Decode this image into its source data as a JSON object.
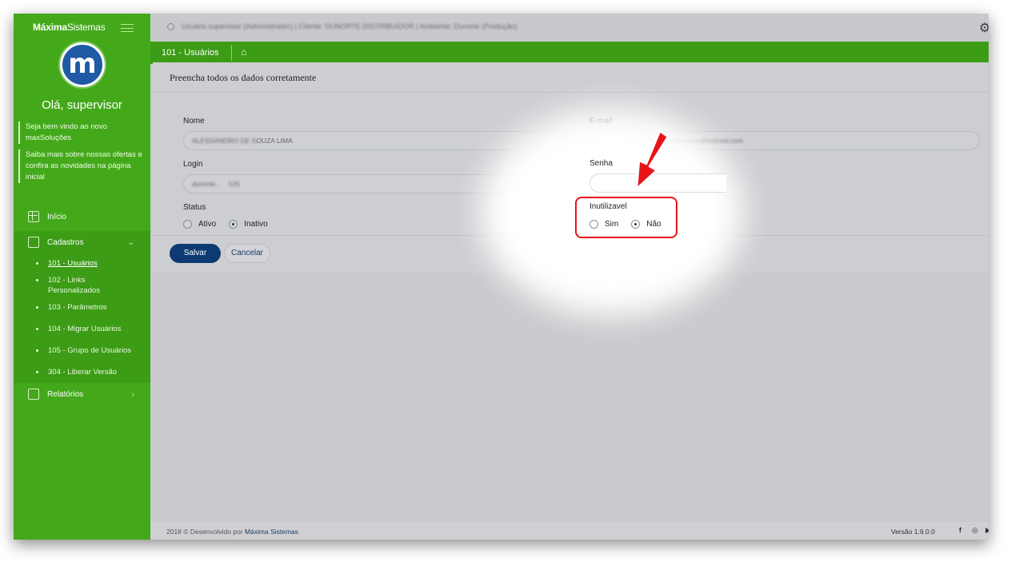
{
  "sidebar": {
    "brand_bold": "Máxima",
    "brand_light": "Sistemas",
    "logo_letter": "m",
    "greeting": "Olá, supervisor",
    "notice1": "Seja bem vindo ao novo maxSoluções",
    "notice2": "Saiba mais sobre nossas ofertas e confira as novidades na página inicial",
    "nav": {
      "inicio": "Início",
      "cadastros": "Cadastros",
      "relatorios": "Relatórios",
      "chevron_down": "⌄",
      "chevron_right": "›"
    },
    "sub_items": [
      "101 - Usuários",
      "102 - Links Personalizados",
      "103 - Parâmetros",
      "104 - Migrar Usuários",
      "105 - Grupo de Usuários",
      "304 - Liberar Versão"
    ]
  },
  "topbar": {
    "user_info": "Usuário supervisor (Administrador) | Cliente: DUNORTE DISTRIBUIDOR | Ambiente: Dunorte (Produção)",
    "gear": "⚙"
  },
  "breadcrumb": {
    "current": "101 - Usuários",
    "home_icon": "⌂"
  },
  "form": {
    "title": "Preencha todos os dados corretamente",
    "nome_label": "Nome",
    "nome_value_blur": "ALESSANDRO DE S",
    "nome_value": "OUZA LIMA",
    "email_label": "E-mail",
    "email_value": "mgr_1_alessandro.dunorte.souza@hotmail.com",
    "login_label": "Login",
    "login_prefix": "dunorte..",
    "login_value": "126",
    "senha_label": "Senha",
    "status_label": "Status",
    "status_options": [
      "Ativo",
      "Inativo"
    ],
    "inutilizavel_label": "Inutilizavel",
    "inutilizavel_options": [
      "Sim",
      "Não"
    ],
    "save_label": "Salvar",
    "cancel_label": "Cancelar"
  },
  "footer": {
    "text": "2018 © Desenvolvido por",
    "company": "Máxima Sistemas",
    "version": "Versão 1.9.0.0",
    "facebook": "f",
    "instagram": "◎",
    "youtube": "▶"
  },
  "colors": {
    "sidebar": "#43a91a",
    "greenbar": "#3c9c16",
    "save": "#0e3a73",
    "highlight": "#e8141a"
  }
}
